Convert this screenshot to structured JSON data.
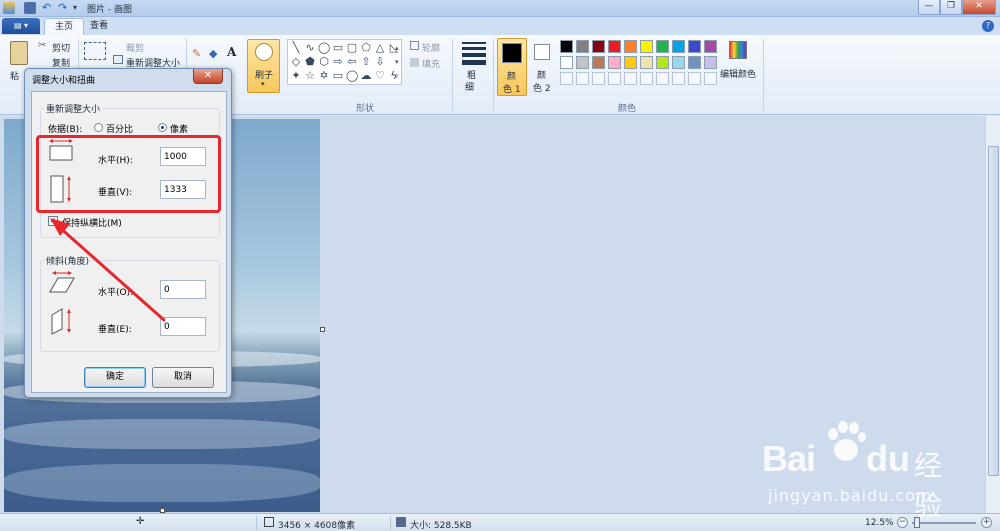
{
  "window": {
    "title": "图片 - 画图",
    "minimize": "—",
    "maximize": "❐",
    "close": "✕",
    "help": "?"
  },
  "tabs": {
    "file": "▤ ▾",
    "home": "主页",
    "view": "查看"
  },
  "ribbon": {
    "clipboard": {
      "paste": "粘",
      "cut": "剪切",
      "copy": "复制"
    },
    "image": {
      "crop": "裁剪",
      "resize": "重新调整大小"
    },
    "brush": "刷子",
    "outline": "轮廓",
    "fill": "填充",
    "shapes_label": "形状",
    "size": [
      "粗",
      "细"
    ],
    "color1": [
      "颜",
      "色 1"
    ],
    "color2": [
      "颜",
      "色 2"
    ],
    "edit_colors": "编辑颜色",
    "colors_label": "颜色",
    "color1_value": "#000000",
    "color2_value": "#ffffff",
    "palette_row1": [
      "#000000",
      "#7f7f7f",
      "#880015",
      "#ed1c24",
      "#ff7f27",
      "#fff200",
      "#22b14c",
      "#00a2e8",
      "#3f48cc",
      "#a349a4"
    ],
    "palette_row2": [
      "#ffffff",
      "#c3c3c3",
      "#b97a57",
      "#ffaec9",
      "#ffc90e",
      "#efe4b0",
      "#b5e61d",
      "#99d9ea",
      "#7092be",
      "#c8bfe7"
    ]
  },
  "dialog": {
    "title": "调整大小和扭曲",
    "close": "✕",
    "resize_group": "重新调整大小",
    "by_label": "依据(B):",
    "percent": "百分比",
    "pixels": "像素",
    "horizontal_label": "水平(H):",
    "horizontal_value": "1000",
    "vertical_label": "垂直(V):",
    "vertical_value": "1333",
    "keep_ratio": "保持纵横比(M)",
    "keep_ratio_checked": true,
    "skew_group": "倾斜(角度)",
    "skew_h_label": "水平(O):",
    "skew_h_value": "0",
    "skew_v_label": "垂直(E):",
    "skew_v_value": "0",
    "ok": "确定",
    "cancel": "取消"
  },
  "status": {
    "dimensions": "3456 × 4608像素",
    "size": "大小: 528.5KB",
    "zoom": "12.5%",
    "zoom_out": "−",
    "zoom_in": "+"
  },
  "watermark": {
    "brand": "Bai",
    "brand2": "du",
    "brand_cn": "经验",
    "url": "jingyan.baidu.com"
  },
  "colors": {
    "annotation_red": "#e8262d",
    "accent_blue": "#2f68c6"
  }
}
